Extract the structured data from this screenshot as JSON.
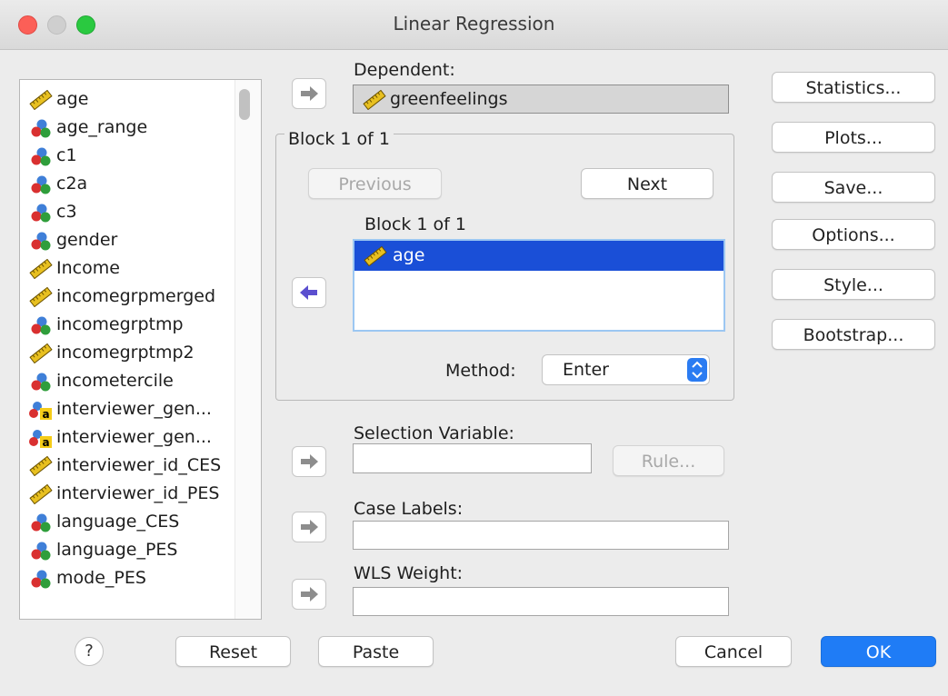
{
  "window": {
    "title": "Linear Regression"
  },
  "variables": [
    {
      "name": "age",
      "type": "scale"
    },
    {
      "name": "age_range",
      "type": "nominal"
    },
    {
      "name": "c1",
      "type": "nominal"
    },
    {
      "name": "c2a",
      "type": "nominal"
    },
    {
      "name": "c3",
      "type": "nominal"
    },
    {
      "name": "gender",
      "type": "nominal"
    },
    {
      "name": "Income",
      "type": "scale"
    },
    {
      "name": "incomegrpmerged",
      "type": "scale"
    },
    {
      "name": "incomegrptmp",
      "type": "nominal"
    },
    {
      "name": "incomegrptmp2",
      "type": "scale"
    },
    {
      "name": "incometercile",
      "type": "nominal"
    },
    {
      "name": "interviewer_gen...",
      "type": "string-nominal"
    },
    {
      "name": "interviewer_gen...",
      "type": "string-nominal"
    },
    {
      "name": "interviewer_id_CES",
      "type": "scale"
    },
    {
      "name": "interviewer_id_PES",
      "type": "scale"
    },
    {
      "name": "language_CES",
      "type": "nominal"
    },
    {
      "name": "language_PES",
      "type": "nominal"
    },
    {
      "name": "mode_PES",
      "type": "nominal"
    }
  ],
  "dependent": {
    "label": "Dependent:",
    "value": "greenfeelings"
  },
  "block": {
    "legend": "Block 1 of 1",
    "previous_label": "Previous",
    "next_label": "Next",
    "inner_label": "Block 1 of 1",
    "items": [
      "age"
    ],
    "method_label": "Method:",
    "method_value": "Enter"
  },
  "selection": {
    "label": "Selection Variable:",
    "value": "",
    "rule_label": "Rule..."
  },
  "case_labels": {
    "label": "Case Labels:",
    "value": ""
  },
  "wls": {
    "label": "WLS Weight:",
    "value": ""
  },
  "side_buttons": [
    "Statistics...",
    "Plots...",
    "Save...",
    "Options...",
    "Style...",
    "Bootstrap..."
  ],
  "footer": {
    "help": "?",
    "reset": "Reset",
    "paste": "Paste",
    "cancel": "Cancel",
    "ok": "OK"
  },
  "colors": {
    "accent": "#1f7cf6",
    "selection": "#1a4fd7",
    "close": "#fc5f57",
    "zoom": "#2ac940"
  },
  "icons": {
    "scale": "ruler-icon",
    "nominal": "balls-icon",
    "string-nominal": "balls-a-icon",
    "move": "arrow-right-icon",
    "move-back": "arrow-left-icon"
  }
}
